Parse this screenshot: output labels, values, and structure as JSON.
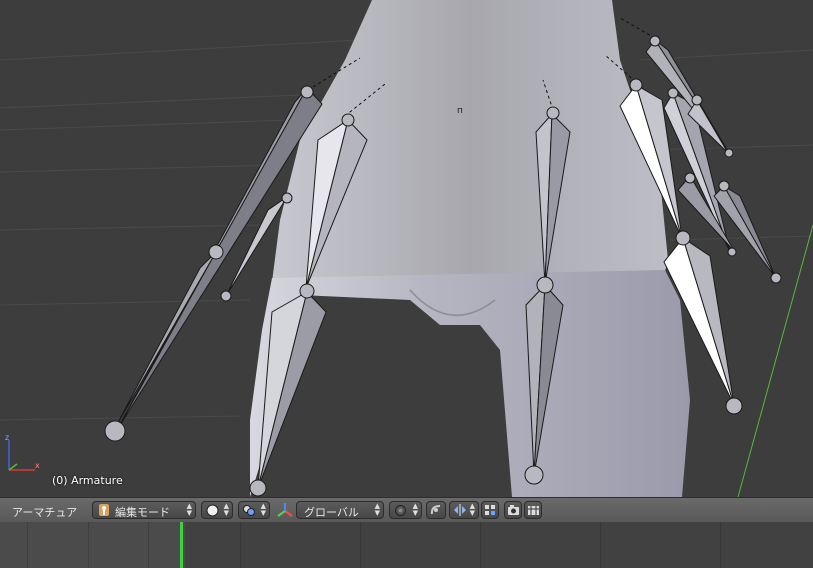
{
  "viewport": {
    "object_label": "(0) Armature",
    "axis_x": "x",
    "axis_z": "z"
  },
  "header": {
    "editor_label": "アーマチュア",
    "mode_icon": "armature-mode-icon",
    "mode_label": "編集モード",
    "shading_icon": "solid-shading-icon",
    "pivot_icon": "pivot-point-icon",
    "orientation_icon": "manipulator-orientation-icon",
    "orientation_label": "グローバル",
    "snap_icon": "snap-target-icon",
    "proportional_icon": "proportional-edit-icon",
    "mirror_icon": "x-axis-mirror-icon",
    "layers_icon": "layers-icon",
    "render_icon": "opengl-render-icon",
    "render_anim_icon": "opengl-animation-icon"
  },
  "timeline": {
    "current_frame_color": "#3fd13f"
  },
  "colors": {
    "header_bg": "#5f5f5f",
    "viewport_bg": "#3d3d3d",
    "bone_fill": "#b0b0b8",
    "bone_selected": "#ffffff"
  }
}
